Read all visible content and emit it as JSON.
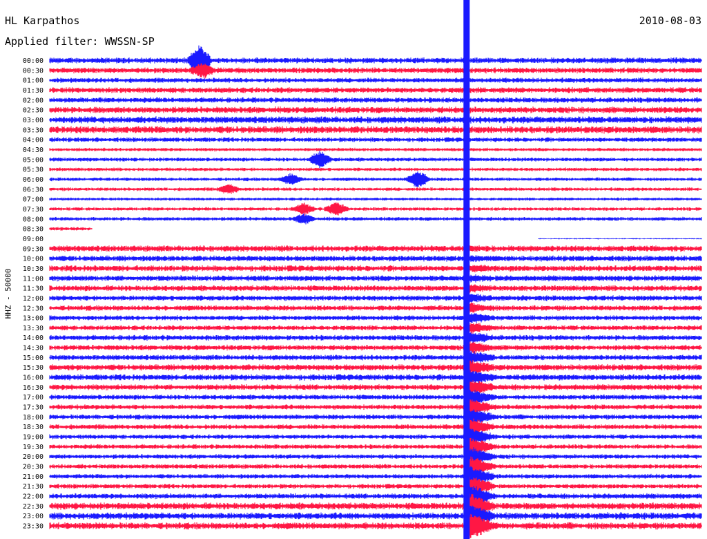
{
  "header": {
    "station": "HL Karpathos",
    "date": "2010-08-03",
    "filter": "Applied filter: WWSSN-SP"
  },
  "chart_data": {
    "type": "line",
    "ylabel": "HHZ - 50000",
    "colors": {
      "blue": "#1a1aff",
      "red": "#ff1744"
    },
    "row_labels": [
      "00:00",
      "00:30",
      "01:00",
      "01:30",
      "02:00",
      "02:30",
      "03:00",
      "03:30",
      "04:00",
      "04:30",
      "05:00",
      "05:30",
      "06:00",
      "06:30",
      "07:00",
      "07:30",
      "08:00",
      "08:30",
      "09:00",
      "09:30",
      "10:00",
      "10:30",
      "11:00",
      "11:30",
      "12:00",
      "12:30",
      "13:00",
      "13:30",
      "14:00",
      "14:30",
      "15:00",
      "15:30",
      "16:00",
      "16:30",
      "17:00",
      "17:30",
      "18:00",
      "18:30",
      "19:00",
      "19:30",
      "20:00",
      "20:30",
      "21:00",
      "21:30",
      "22:00",
      "22:30",
      "23:00",
      "23:30"
    ],
    "trace_colors": [
      "blue",
      "red",
      "blue",
      "red",
      "blue",
      "red",
      "blue",
      "red",
      "blue",
      "red",
      "blue",
      "red",
      "blue",
      "red",
      "blue",
      "red",
      "blue",
      "red",
      "blue",
      "red",
      "blue",
      "red",
      "blue",
      "red",
      "blue",
      "red",
      "blue",
      "red",
      "blue",
      "red",
      "blue",
      "red",
      "blue",
      "red",
      "blue",
      "red",
      "blue",
      "red",
      "blue",
      "red",
      "blue",
      "red",
      "blue",
      "red",
      "blue",
      "red",
      "blue",
      "red"
    ],
    "trace_level": [
      0.6,
      0.6,
      0.5,
      0.6,
      0.55,
      0.7,
      0.75,
      0.8,
      0.45,
      0.3,
      0.35,
      0.3,
      0.3,
      0.3,
      0.25,
      0.3,
      0.35,
      0.3,
      0,
      0.65,
      0.6,
      0.65,
      0.6,
      0.6,
      0.55,
      0.55,
      0.5,
      0.5,
      0.55,
      0.55,
      0.55,
      0.65,
      0.65,
      0.6,
      0.5,
      0.5,
      0.5,
      0.5,
      0.45,
      0.45,
      0.45,
      0.45,
      0.45,
      0.45,
      0.55,
      0.75,
      0.75,
      0.75
    ],
    "trace_start": [
      0,
      0,
      0,
      0,
      0,
      0,
      0,
      0,
      0,
      0,
      0,
      0,
      0,
      0,
      0,
      0,
      0,
      0,
      0.75,
      0,
      0,
      0,
      0,
      0,
      0,
      0,
      0,
      0,
      0,
      0,
      0,
      0,
      0,
      0,
      0,
      0,
      0,
      0,
      0,
      0,
      0,
      0,
      0,
      0,
      0,
      0,
      0,
      0
    ],
    "trace_end": [
      1,
      1,
      1,
      1,
      1,
      1,
      1,
      1,
      1,
      1,
      1,
      1,
      1,
      1,
      1,
      1,
      1,
      0.065,
      1,
      1,
      1,
      1,
      1,
      1,
      1,
      1,
      1,
      1,
      1,
      1,
      1,
      1,
      1,
      1,
      1,
      1,
      1,
      1,
      1,
      1,
      1,
      1,
      1,
      1,
      1,
      1,
      1,
      1
    ],
    "events": [
      {
        "row": 0,
        "x": 0.23,
        "amp": 3.5
      },
      {
        "row": 1,
        "x": 0.235,
        "amp": 1.5
      },
      {
        "row": 10,
        "x": 0.415,
        "amp": 1.8
      },
      {
        "row": 12,
        "x": 0.37,
        "amp": 1.2
      },
      {
        "row": 12,
        "x": 0.565,
        "amp": 2.0
      },
      {
        "row": 13,
        "x": 0.275,
        "amp": 1.0
      },
      {
        "row": 15,
        "x": 0.39,
        "amp": 1.2
      },
      {
        "row": 15,
        "x": 0.44,
        "amp": 1.5
      },
      {
        "row": 16,
        "x": 0.39,
        "amp": 1.0
      }
    ],
    "big_event": {
      "row": 19,
      "x": 0.638,
      "note": "large quake saturates rows 19-47 at this time-of-day column"
    }
  }
}
